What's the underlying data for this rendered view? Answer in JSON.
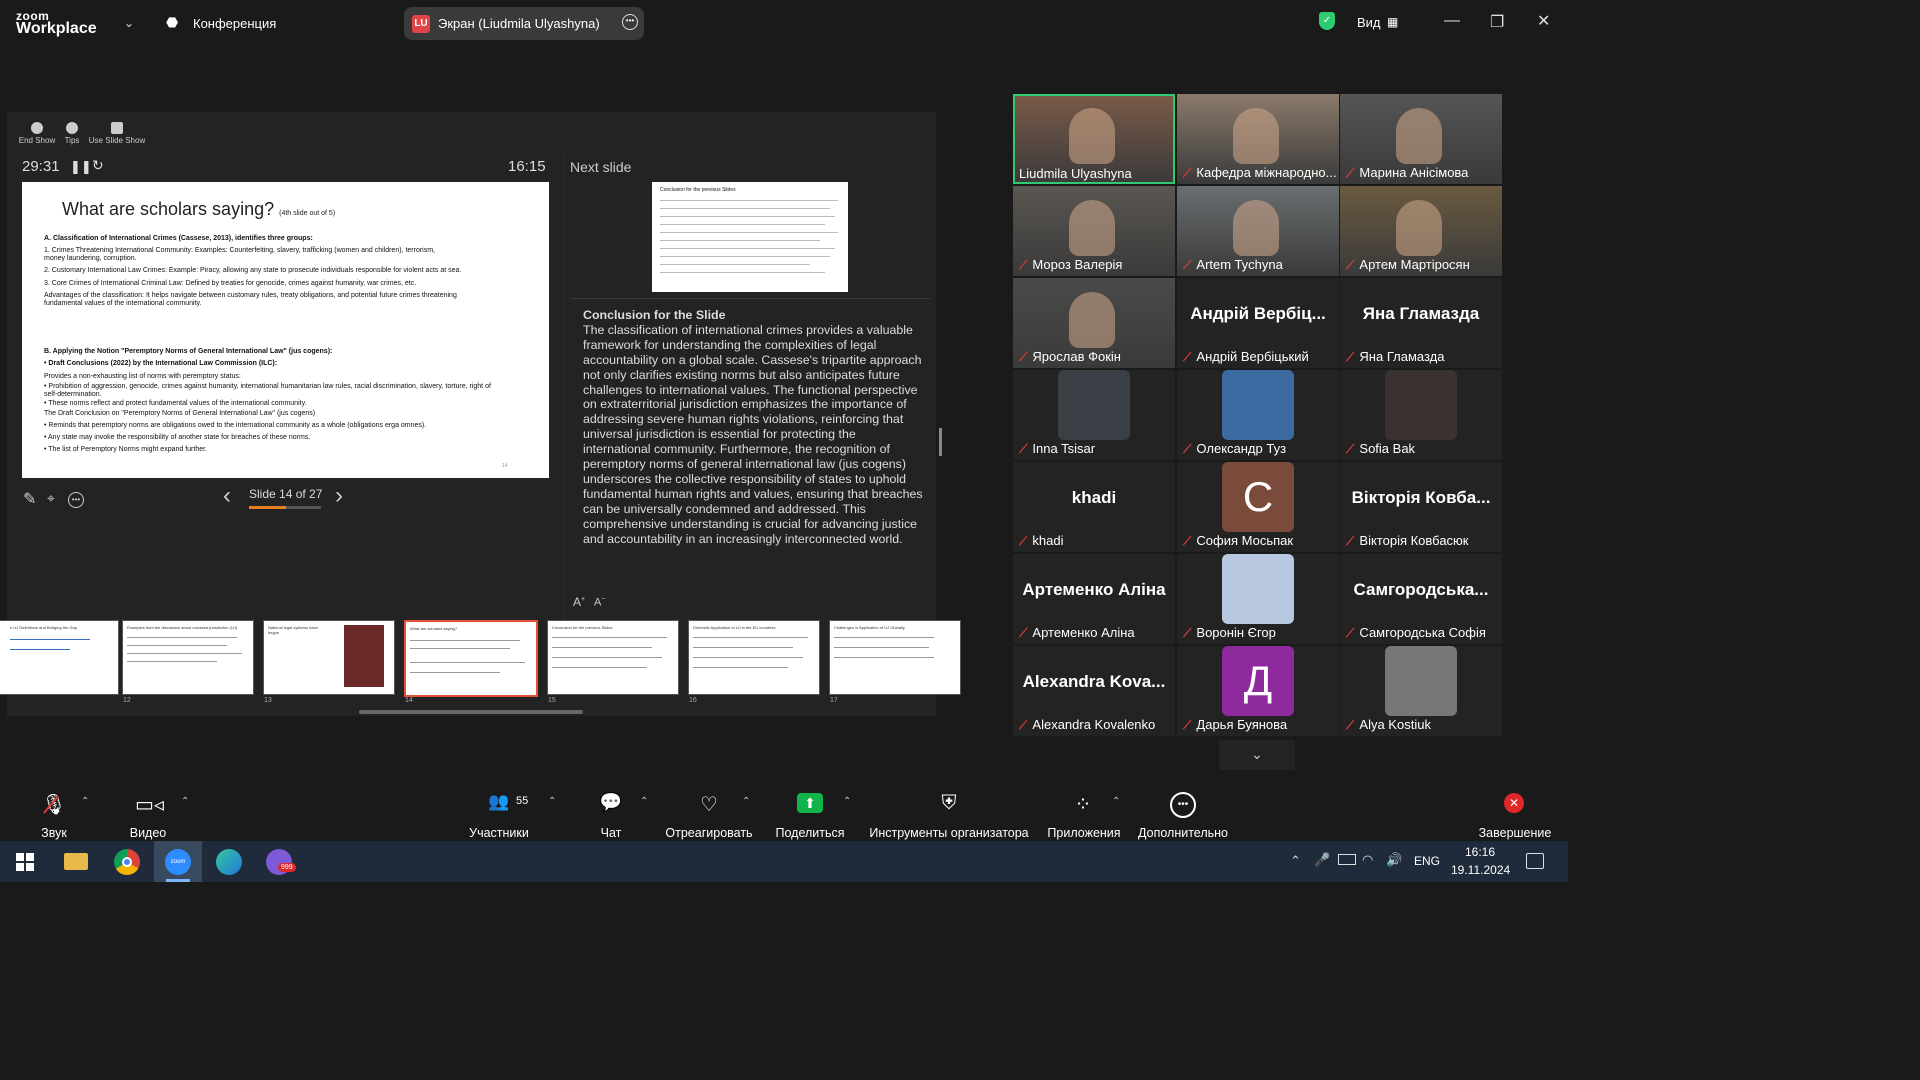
{
  "app": {
    "brand_top": "zoom",
    "brand_bottom": "Workplace",
    "conference_label": "Конференция",
    "view_label": "Вид"
  },
  "screen_share": {
    "badge": "LU",
    "label": "Экран (Liudmila Ulyashyna)"
  },
  "presenter": {
    "controls": [
      "End Show",
      "Tips",
      "Use Slide Show"
    ],
    "elapsed": "29:31",
    "clock": "16:15",
    "next_slide_label": "Next slide",
    "slide_counter": "Slide 14 of 27",
    "slide": {
      "title": "What are scholars saying?",
      "title_small": "(4th slide out of 5)",
      "lines": [
        "A. Classification of International Crimes (Cassese, 2013), identifies three groups:",
        "1.      Crimes Threatening International Community: Examples: Counterfeiting, slavery, trafficking (women and children), terrorism,",
        "         money laundering, corruption.",
        "2.      Customary International Law Crimes: Example: Piracy, allowing any state to prosecute individuals responsible for violent acts at sea.",
        "3.      Core Crimes of International Criminal Law: Defined by treaties for genocide, crimes against humanity, war crimes, etc.",
        "Advantages of the classification: It helps navigate between customary rules, treaty obligations, and potential future crimes threatening",
        "fundamental values of the international community.",
        "B. Applying the Notion \"Peremptory Norms of General International Law\" (jus cogens):",
        "•   Draft Conclusions (2022) by the International Law Commission (ILC):",
        "Provides a non-exhausting list of norms with peremptory status:",
        "     •   Prohibition of aggression, genocide, crimes against humanity, international humanitarian law rules, racial discrimination, slavery, torture, right of",
        "         self-determination.",
        "     •   These norms reflect and protect fundamental values of the international community.",
        "The Draft Conclusion on \"Peremptory Norms of General International Law\" (jus cogens)",
        "•   Reminds that peremptory norms are obligations owed to the international community as a whole (obligations erga omnes).",
        "•   Any state may invoke the responsibility of another state for breaches of these norms.",
        "•   The list of Peremptory Norms might expand further."
      ],
      "page_no": "14"
    },
    "next_slide_title": "Conclusion for the previous Slides",
    "notes_heading": "Conclusion for the Slide",
    "notes_body": "The classification of international crimes provides a valuable framework for understanding the complexities of legal accountability on a global scale. Cassese's tripartite approach not only clarifies existing norms but also anticipates future challenges to international values. The functional perspective on extraterritorial jurisdiction emphasizes the importance of addressing severe human rights violations, reinforcing that universal jurisdiction is essential for protecting the international community. Furthermore, the recognition of peremptory norms of general international law (jus cogens) underscores the collective responsibility of states to uphold fundamental human rights and values, ensuring that breaches can be universally condemned and addressed. This comprehensive understanding is crucial for advancing justice and accountability in an increasingly interconnected world.",
    "thumbnails": [
      {
        "num": "",
        "title": "n UJ Definitions and Bridging the Gap"
      },
      {
        "num": "12",
        "title": "Examples from the discussion about universal jurisdiction (UJ)"
      },
      {
        "num": "13",
        "title": "National legal systems have begun"
      },
      {
        "num": "14",
        "title": "What are scholars saying?"
      },
      {
        "num": "15",
        "title": "Conclusion for the previous Slides"
      },
      {
        "num": "16",
        "title": "Domestic Application of UJ in the EU countries"
      },
      {
        "num": "17",
        "title": "Challenges in Application of UJ Globally"
      }
    ]
  },
  "participants_grid": [
    {
      "name": "Liudmila Ulyashyna",
      "muted": false,
      "type": "video",
      "color": "#7a5a48",
      "active": true
    },
    {
      "name": "Кафедра міжнародно...",
      "muted": true,
      "type": "video",
      "color": "#8a7a6a"
    },
    {
      "name": "Марина Анісімова",
      "muted": true,
      "type": "video",
      "color": "#555"
    },
    {
      "name": "Мороз Валерія",
      "muted": true,
      "type": "video",
      "color": "#5a5650"
    },
    {
      "name": "Artem Tychyna",
      "muted": true,
      "type": "video",
      "color": "#6a6e70"
    },
    {
      "name": "Артем Мартіросян",
      "muted": true,
      "type": "video",
      "color": "#6a5a40"
    },
    {
      "name": "Ярослав Фокін",
      "muted": true,
      "type": "video",
      "color": "#4a4a48"
    },
    {
      "name": "Андрій Вербіцький",
      "muted": true,
      "type": "name",
      "big": "Андрій Вербіц..."
    },
    {
      "name": "Яна Гламазда",
      "muted": true,
      "type": "name",
      "big": "Яна Гламазда"
    },
    {
      "name": "Inna Tsisar",
      "muted": true,
      "type": "photo",
      "color": "#3a3f45"
    },
    {
      "name": "Олександр Туз",
      "muted": true,
      "type": "photo",
      "color": "#3a6aa0"
    },
    {
      "name": "Sofia Bak",
      "muted": true,
      "type": "photo",
      "color": "#3a3230"
    },
    {
      "name": "khadi",
      "muted": true,
      "type": "name",
      "big": "khadi"
    },
    {
      "name": "София Мосьпак",
      "muted": true,
      "type": "letter",
      "letter": "C",
      "color": "#7a4a3a"
    },
    {
      "name": "Вікторія Ковбасюк",
      "muted": true,
      "type": "name",
      "big": "Вікторія Ковба..."
    },
    {
      "name": "Артеменко Аліна",
      "muted": true,
      "type": "name",
      "big": "Артеменко Аліна"
    },
    {
      "name": "Воронін Єгор",
      "muted": true,
      "type": "photo",
      "color": "#b8c8e0"
    },
    {
      "name": "Самгородська Софія",
      "muted": true,
      "type": "name",
      "big": "Самгородська..."
    },
    {
      "name": "Alexandra Kovalenko",
      "muted": true,
      "type": "name",
      "big": "Alexandra Kova..."
    },
    {
      "name": "Дарья Буянова",
      "muted": true,
      "type": "letter",
      "letter": "Д",
      "color": "#8e2a9e"
    },
    {
      "name": "Alya Kostiuk",
      "muted": true,
      "type": "photo",
      "color": "#777"
    }
  ],
  "toolbar": {
    "audio": "Звук",
    "video": "Видео",
    "participants": "Участники",
    "participants_count": "55",
    "chat": "Чат",
    "react": "Отреагировать",
    "share": "Поделиться",
    "host_tools": "Инструменты организатора",
    "apps": "Приложения",
    "more": "Дополнительно",
    "end": "Завершение"
  },
  "taskbar": {
    "lang": "ENG",
    "time": "16:16",
    "date": "19.11.2024",
    "badge": "999"
  },
  "colors": {
    "accent_green": "#2ecc71",
    "mute_red": "#e03b3b",
    "share_green": "#12b34a",
    "end_red": "#e02828"
  }
}
